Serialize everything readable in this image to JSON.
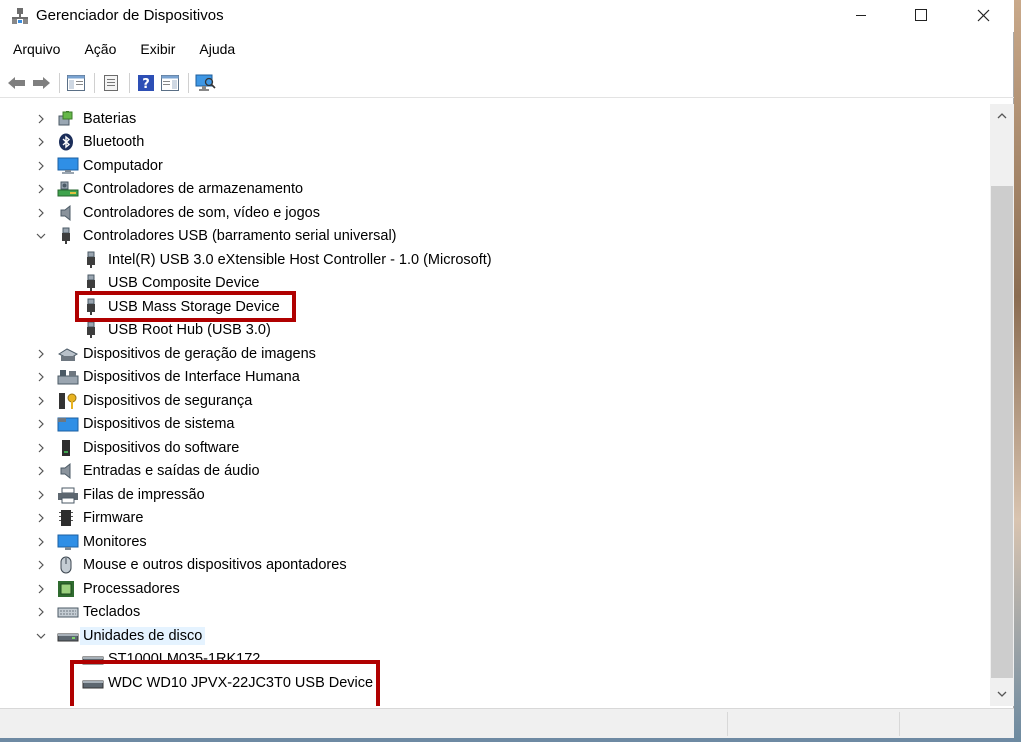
{
  "window": {
    "title": "Gerenciador de Dispositivos",
    "minimize_glyph": "—",
    "maximize_glyph": "☐",
    "close_glyph": "✕"
  },
  "menu": [
    "Arquivo",
    "Ação",
    "Exibir",
    "Ajuda"
  ],
  "toolbar": {
    "buttons": [
      "back-arrow-icon",
      "forward-arrow-icon",
      "show-hide-console-tree-icon",
      "properties-icon",
      "help-icon",
      "action-pane-icon",
      "scan-hardware-icon"
    ]
  },
  "tree": {
    "categories": [
      {
        "label": "Baterias",
        "icon": "battery-icon",
        "expanded": false
      },
      {
        "label": "Bluetooth",
        "icon": "bluetooth-icon",
        "expanded": false
      },
      {
        "label": "Computador",
        "icon": "computer-icon",
        "expanded": false
      },
      {
        "label": "Controladores de armazenamento",
        "icon": "storage-controller-icon",
        "expanded": false
      },
      {
        "label": "Controladores de som, vídeo e jogos",
        "icon": "speaker-icon",
        "expanded": false
      },
      {
        "label": "Controladores USB (barramento serial universal)",
        "icon": "usb-plug-icon",
        "expanded": true,
        "children": [
          {
            "label": "Intel(R) USB 3.0 eXtensible Host Controller - 1.0 (Microsoft)",
            "icon": "usb-plug-icon"
          },
          {
            "label": "USB Composite Device",
            "icon": "usb-plug-icon"
          },
          {
            "label": "USB Mass Storage Device",
            "icon": "usb-plug-icon",
            "highlighted": true
          },
          {
            "label": "USB Root Hub (USB 3.0)",
            "icon": "usb-plug-icon"
          }
        ]
      },
      {
        "label": "Dispositivos de geração de imagens",
        "icon": "camera-icon",
        "expanded": false
      },
      {
        "label": "Dispositivos de Interface Humana",
        "icon": "hid-icon",
        "expanded": false
      },
      {
        "label": "Dispositivos de segurança",
        "icon": "security-key-icon",
        "expanded": false
      },
      {
        "label": "Dispositivos de sistema",
        "icon": "system-folder-icon",
        "expanded": false
      },
      {
        "label": "Dispositivos do software",
        "icon": "software-device-icon",
        "expanded": false
      },
      {
        "label": "Entradas e saídas de áudio",
        "icon": "audio-speaker-icon",
        "expanded": false
      },
      {
        "label": "Filas de impressão",
        "icon": "printer-icon",
        "expanded": false
      },
      {
        "label": "Firmware",
        "icon": "firmware-chip-icon",
        "expanded": false
      },
      {
        "label": "Monitores",
        "icon": "monitor-icon",
        "expanded": false
      },
      {
        "label": "Mouse e outros dispositivos apontadores",
        "icon": "mouse-icon",
        "expanded": false
      },
      {
        "label": "Processadores",
        "icon": "processor-icon",
        "expanded": false
      },
      {
        "label": "Teclados",
        "icon": "keyboard-icon",
        "expanded": false
      },
      {
        "label": "Unidades de disco",
        "icon": "disk-drive-icon",
        "expanded": true,
        "selected": true,
        "children": [
          {
            "label": "ST1000LM035-1RK172",
            "icon": "disk-drive-icon"
          },
          {
            "label": "WDC WD10 JPVX-22JC3T0 USB Device",
            "icon": "disk-drive-icon",
            "highlighted": true
          }
        ]
      }
    ]
  },
  "colors": {
    "highlight_box": "#b00000",
    "selection": "#e5f3ff",
    "monitor_blue": "#1e88e5"
  }
}
